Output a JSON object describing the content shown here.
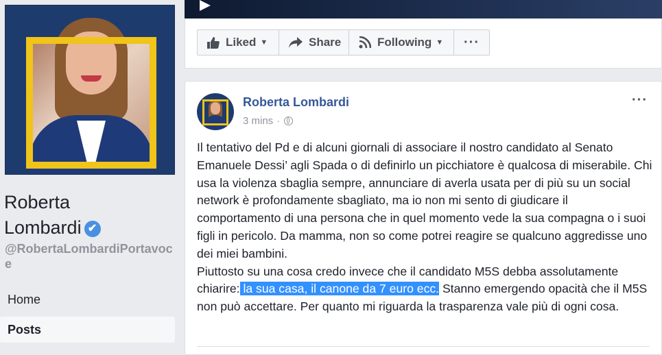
{
  "sidebar": {
    "page_name_first": "Roberta",
    "page_name_last": "Lombardi",
    "verified_glyph": "✔",
    "handle": "@RobertaLombardiPortavoce",
    "nav": [
      {
        "label": "Home",
        "active": false
      },
      {
        "label": "Posts",
        "active": true
      }
    ]
  },
  "actions": {
    "liked_label": "Liked",
    "share_label": "Share",
    "following_label": "Following",
    "more_label": "···",
    "icons": [
      "thumbs-up-icon",
      "share-arrow-icon",
      "rss-icon"
    ]
  },
  "post": {
    "author": "Roberta Lombardi",
    "time": "3 mins",
    "separator": "·",
    "options_label": "···",
    "paragraph1": "Il tentativo del Pd e di alcuni giornali di associare il nostro candidato al Senato Emanuele Dessi’ agli Spada o di definirlo un picchiatore è qualcosa di miserabile. Chi usa la violenza sbaglia sempre, annunciare di averla usata per di più su un social network è profondamente sbagliato, ma io non mi sento di giudicare il comportamento di una persona che in quel momento vede la sua compagna o i suoi figli in pericolo. Da mamma, non so come potrei reagire se qualcuno aggredisse uno dei miei bambini.",
    "paragraph2_before": "Piuttosto su una cosa credo invece che il candidato M5S debba assolutamente chiarire:",
    "paragraph2_highlight": " la sua casa, il canone da 7 euro ecc.",
    "paragraph2_after": " Stanno emergendo opacità che il M5S non può accettare. Per quanto mi riguarda la trasparenza vale più di ogni cosa."
  },
  "colors": {
    "link_blue": "#365899",
    "verified_blue": "#4a90e2",
    "selection_blue": "#3390ff",
    "frame_yellow": "#f0c419"
  }
}
